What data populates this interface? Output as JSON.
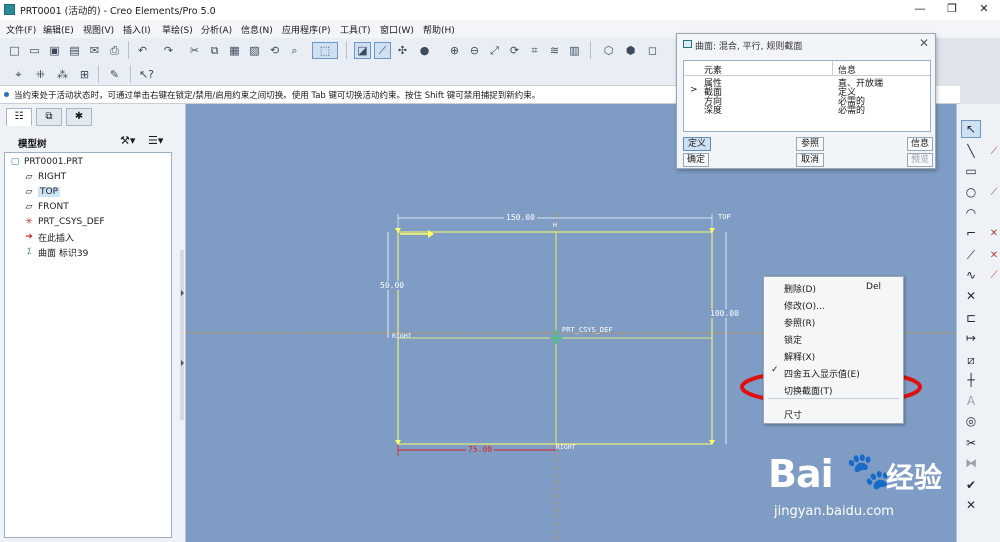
{
  "window": {
    "title": "PRT0001 (活动的) - Creo Elements/Pro 5.0",
    "minimize": "—",
    "restore": "❐",
    "close": "✕"
  },
  "menu": [
    "文件(F)",
    "编辑(E)",
    "视图(V)",
    "插入(I)",
    "草绘(S)",
    "分析(A)",
    "信息(N)",
    "应用程序(P)",
    "工具(T)",
    "窗口(W)",
    "帮助(H)"
  ],
  "status_message": "当约束处于活动状态时，可通过单击右键在锁定/禁用/启用约束之间切换。使用 Tab 键可切换活动约束。按住 Shift 键可禁用捕捉到新约束。",
  "left_panel": {
    "header": "模型树",
    "tree": [
      {
        "icon": "part-icon",
        "glyph": "▢",
        "label": "PRT0001.PRT"
      },
      {
        "icon": "datum-plane-icon",
        "glyph": "▱",
        "label": "RIGHT"
      },
      {
        "icon": "datum-plane-icon",
        "glyph": "▱",
        "label": "TOP"
      },
      {
        "icon": "datum-plane-icon",
        "glyph": "▱",
        "label": "FRONT"
      },
      {
        "icon": "coordinate-system-icon",
        "glyph": "✳",
        "label": "PRT_CSYS_DEF"
      },
      {
        "icon": "insert-here-arrow-icon",
        "glyph": "➔",
        "label": "在此插入"
      },
      {
        "icon": "surface-feature-icon",
        "glyph": "⁒",
        "label": "曲面 标识39"
      }
    ]
  },
  "dialog": {
    "title": "曲面: 混合, 平行, 规则截面",
    "col_element": "元素",
    "col_info": "信息",
    "rows": [
      {
        "element": "属性",
        "info": "直、开放端"
      },
      {
        "element": "截面",
        "info": "定义"
      },
      {
        "element": "方向",
        "info": "必需的"
      },
      {
        "element": "深度",
        "info": "必需的"
      }
    ],
    "current_row_marker": ">",
    "buttons": {
      "define": "定义",
      "reference": "参照",
      "info": "信息",
      "ok": "确定",
      "cancel": "取消",
      "preview": "预览"
    }
  },
  "sketch": {
    "dim_top": "150.00",
    "dim_left": "50.00",
    "dim_right": "100.00",
    "dim_bottom": "75.00",
    "label_top": "TOP",
    "label_right_plane": "RIGHT",
    "label_right_plane_bottom": "RIGHT",
    "label_csys": "PRT_CSYS_DEF",
    "label_h": "H"
  },
  "context_menu": {
    "items": [
      {
        "label": "删除(D)",
        "key": "Del"
      },
      {
        "label": "修改(O)..."
      },
      {
        "label": "参照(R)"
      },
      {
        "label": "锁定"
      },
      {
        "label": "解释(X)"
      },
      {
        "label": "四舍五入显示值(E)",
        "checked": true
      },
      {
        "label": "切换截面(T)"
      },
      {
        "label": "尺寸"
      }
    ]
  },
  "watermark": {
    "brand": "Bai",
    "brand2": "经验",
    "url": "jingyan.baidu.com"
  },
  "colors": {
    "canvas": "#7e9cc4",
    "sketch_line": "#ffff66",
    "dim_text": "#ffffff",
    "highlight_ellipse": "#e01010",
    "dim_line_red": "#e02020"
  }
}
